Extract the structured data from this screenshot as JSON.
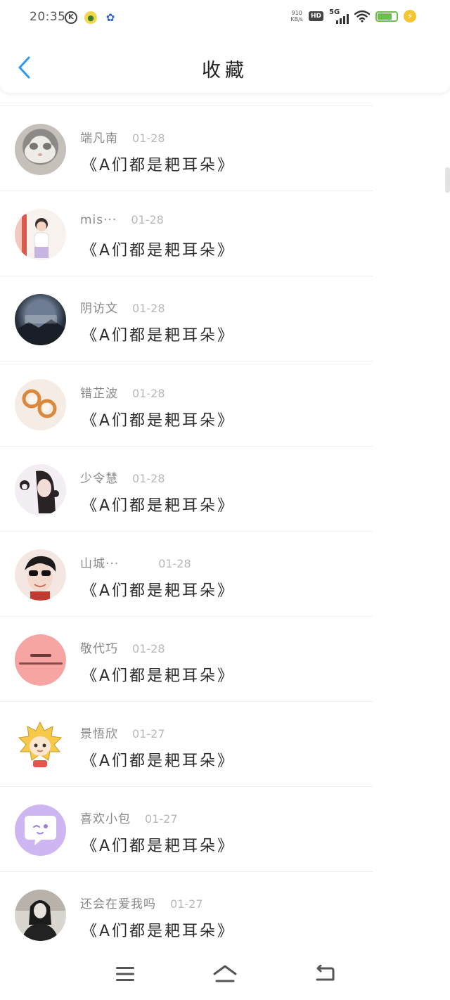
{
  "status_bar": {
    "time": "20:35",
    "speed_top": "910",
    "speed_bottom": "KB/s",
    "hd_label": "HD",
    "network_label": "5G",
    "left_icons": [
      "k-circle-icon",
      "mascot-icon",
      "paw-icon"
    ],
    "right_icons": [
      "signal-icon",
      "wifi-icon",
      "battery-icon",
      "charging-icon"
    ],
    "battery_color": "#6cbf4c"
  },
  "header": {
    "title": "收藏",
    "back_icon": "chevron-left-icon",
    "accent": "#2b9af3"
  },
  "favorites": [
    {
      "name": "端凡南",
      "date": "01-28",
      "title": "《A们都是耙耳朵》",
      "avatar_icon": "cat-photo"
    },
    {
      "name": "mis···",
      "date": "01-28",
      "title": "《A们都是耙耳朵》",
      "avatar_icon": "person-photo"
    },
    {
      "name": "阴访文",
      "date": "01-28",
      "title": "《A们都是耙耳朵》",
      "avatar_icon": "dark-landscape-photo"
    },
    {
      "name": "错芷波",
      "date": "01-28",
      "title": "《A们都是耙耳朵》",
      "avatar_icon": "earrings-photo"
    },
    {
      "name": "少令慧",
      "date": "01-28",
      "title": "《A们都是耙耳朵》",
      "avatar_icon": "girl-photo"
    },
    {
      "name": "山城···",
      "date": "01-28",
      "title": "《A们都是耙耳朵》",
      "avatar_icon": "sunglasses-boy-photo"
    },
    {
      "name": "敬代巧",
      "date": "01-28",
      "title": "《A们都是耙耳朵》",
      "avatar_icon": "pink-text-avatar"
    },
    {
      "name": "景悟欣",
      "date": "01-27",
      "title": "《A们都是耙耳朵》",
      "avatar_icon": "cartoon-avatar"
    },
    {
      "name": "喜欢小包",
      "date": "01-27",
      "title": "《A们都是耙耳朵》",
      "avatar_icon": "purple-chat-avatar"
    },
    {
      "name": "还会在爱我吗",
      "date": "01-27",
      "title": "《A们都是耙耳朵》",
      "avatar_icon": "bw-portrait-photo"
    }
  ],
  "nav_bar": {
    "icons": [
      "menu-icon",
      "home-icon",
      "back-icon"
    ]
  }
}
